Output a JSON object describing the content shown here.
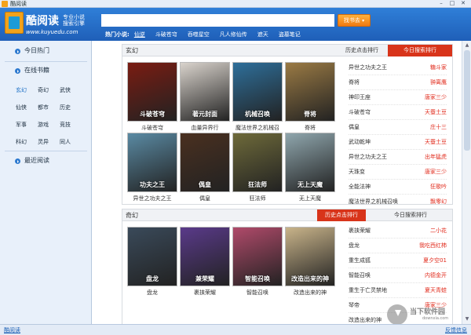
{
  "window": {
    "title": "酷阅读"
  },
  "header": {
    "logo_name": "酷阅读",
    "logo_sub1": "专业小说",
    "logo_sub2": "搜索引擎",
    "logo_url": "www.kuyuedu.com",
    "search_value": "",
    "search_button": "找书去",
    "hot_label": "热门小说:",
    "hot_items": [
      "仙逆",
      "斗破苍穹",
      "吞噬星空",
      "凡人修仙传",
      "遮天",
      "盗墓笔记"
    ]
  },
  "sidebar": {
    "today_hot": "今日热门",
    "online_books": "在线书籍",
    "categories": [
      "玄幻",
      "奇幻",
      "武侠",
      "仙侠",
      "都市",
      "历史",
      "军事",
      "游戏",
      "竞技",
      "科幻",
      "灵异",
      "同人"
    ],
    "recent": "最近阅读"
  },
  "panels": [
    {
      "title": "玄幻",
      "tab_history": "历史点击排行",
      "tab_today": "今日搜索排行",
      "active_tab": "today",
      "books": [
        {
          "name": "斗破苍穹",
          "cover_text": "斗破苍穹",
          "color": "#7a1c12"
        },
        {
          "name": "血量异界行",
          "cover_text": "著元封面",
          "color": "#d9d3cc"
        },
        {
          "name": "魔法世界之机械召",
          "cover_text": "机械召唤",
          "color": "#2e6f9a"
        },
        {
          "name": "脊将",
          "cover_text": "脊将",
          "color": "#9a7a44"
        },
        {
          "name": "异世之功夫之王",
          "cover_text": "功夫之王",
          "color": "#5a8aa3"
        },
        {
          "name": "偶皇",
          "cover_text": "偶皇",
          "color": "#4a3020"
        },
        {
          "name": "狂法师",
          "cover_text": "狂法师",
          "color": "#6e6a3a"
        },
        {
          "name": "无上天魔",
          "cover_text": "无上天魔",
          "color": "#8fa6ad"
        }
      ],
      "ranking": [
        {
          "title": "异世之功夫之王",
          "author": "糖斗家"
        },
        {
          "title": "脊将",
          "author": "翀离鹰"
        },
        {
          "title": "神印王座",
          "author": "唐家三少"
        },
        {
          "title": "斗破苍穹",
          "author": "天蚕土豆"
        },
        {
          "title": "偶皇",
          "author": "庄十三"
        },
        {
          "title": "武动乾坤",
          "author": "天蚕土豆"
        },
        {
          "title": "异世之功夫之王",
          "author": "出年猛虎"
        },
        {
          "title": "天珠变",
          "author": "唐家三少"
        },
        {
          "title": "全能法神",
          "author": "狂歌吟"
        },
        {
          "title": "魔法世界之机械召唤",
          "author": "飘零幻"
        }
      ]
    },
    {
      "title": "奇幻",
      "tab_history": "历史点击排行",
      "tab_today": "今日搜索排行",
      "active_tab": "history",
      "books": [
        {
          "name": "盘龙",
          "cover_text": "盘龙",
          "color": "#3a4a5a"
        },
        {
          "name": "裹挟荣耀",
          "cover_text": "兼荣耀",
          "color": "#5a3a8a"
        },
        {
          "name": "智能召唤",
          "cover_text": "智能召唤",
          "color": "#b04a6a"
        },
        {
          "name": "改造出来的神",
          "cover_text": "改造出来的神",
          "color": "#c9b48a"
        }
      ],
      "ranking": [
        {
          "title": "裹挟荣耀",
          "author": "二小花"
        },
        {
          "title": "盘龙",
          "author": "我吃西红柿"
        },
        {
          "title": "重生成狐",
          "author": "夏夕空01"
        },
        {
          "title": "智能召唤",
          "author": "内德金开"
        },
        {
          "title": "重生于亡灵禁地",
          "author": "夏天青蛙"
        },
        {
          "title": "琴帝",
          "author": "唐家三少"
        },
        {
          "title": "改造出来的神",
          "author": ""
        }
      ]
    }
  ],
  "statusbar": {
    "left": "酷阅读",
    "right": "反馈信息"
  },
  "watermark": {
    "text": "当下软件园",
    "sub": "downxia.com"
  }
}
